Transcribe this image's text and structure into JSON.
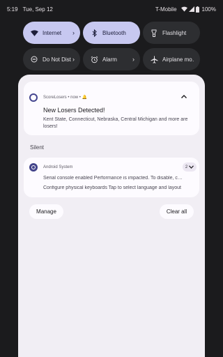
{
  "status_bar": {
    "time": "5:19",
    "date": "Tue, Sep 12",
    "carrier": "T-Mobile",
    "battery": "100%",
    "icons": [
      "wifi-icon",
      "signal-icon",
      "battery-icon"
    ]
  },
  "quick_settings": {
    "tiles": [
      {
        "label": "Internet",
        "icon": "wifi-icon",
        "state": "on",
        "chevron": "›"
      },
      {
        "label": "Bluetooth",
        "icon": "bluetooth-icon",
        "state": "on",
        "chevron": ""
      },
      {
        "label": "Flashlight",
        "icon": "flashlight-icon",
        "state": "off",
        "chevron": ""
      },
      {
        "label": "Do Not Dist…",
        "icon": "do-not-disturb-icon",
        "state": "off",
        "chevron": "›"
      },
      {
        "label": "Alarm",
        "icon": "alarm-icon",
        "state": "off",
        "chevron": "›"
      },
      {
        "label": "Airplane mo…",
        "icon": "airplane-icon",
        "state": "off",
        "chevron": ""
      }
    ]
  },
  "notifications": {
    "alerting": {
      "app_line": "ScoreLosers • now • 🔔",
      "title": "New Losers Detected!",
      "text": "Kent State, Connecticut, Nebraska, Central Michigan and more are losers!"
    },
    "silent_header": "Silent",
    "silent": {
      "app": "Android System",
      "count": "2",
      "lines": [
        "Serial console enabled Performance is impacted. To disable, c…",
        "Configure physical keyboards Tap to select language and layout"
      ]
    },
    "manage_label": "Manage",
    "clear_all_label": "Clear all"
  },
  "colors": {
    "background": "#1b1b1d",
    "tile_on": "#c7c8f0",
    "tile_off": "#2d2e31",
    "panel": "#f1eef4",
    "card": "#fdfbff",
    "accent": "#45468f"
  }
}
